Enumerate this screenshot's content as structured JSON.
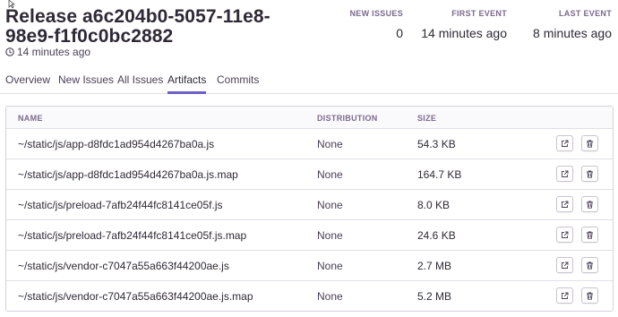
{
  "release": {
    "title": "Release a6c204b0-5057-11e8-98e9-f1f0c0bc2882",
    "age": "14 minutes ago"
  },
  "stats": {
    "new_issues_label": "NEW ISSUES",
    "new_issues_value": "0",
    "first_event_label": "FIRST EVENT",
    "first_event_value": "14 minutes ago",
    "last_event_label": "LAST EVENT",
    "last_event_value": "8 minutes ago"
  },
  "tabs": [
    {
      "label": "Overview",
      "active": false
    },
    {
      "label": "New Issues",
      "active": false
    },
    {
      "label": "All Issues",
      "active": false
    },
    {
      "label": "Artifacts",
      "active": true
    },
    {
      "label": "Commits",
      "active": false
    }
  ],
  "table": {
    "headers": {
      "name": "NAME",
      "distribution": "DISTRIBUTION",
      "size": "SIZE"
    },
    "rows": [
      {
        "name": "~/static/js/app-d8fdc1ad954d4267ba0a.js",
        "distribution": "None",
        "size": "54.3 KB"
      },
      {
        "name": "~/static/js/app-d8fdc1ad954d4267ba0a.js.map",
        "distribution": "None",
        "size": "164.7 KB"
      },
      {
        "name": "~/static/js/preload-7afb24f44fc8141ce05f.js",
        "distribution": "None",
        "size": "8.0 KB"
      },
      {
        "name": "~/static/js/preload-7afb24f44fc8141ce05f.js.map",
        "distribution": "None",
        "size": "24.6 KB"
      },
      {
        "name": "~/static/js/vendor-c7047a55a663f44200ae.js",
        "distribution": "None",
        "size": "2.7 MB"
      },
      {
        "name": "~/static/js/vendor-c7047a55a663f44200ae.js.map",
        "distribution": "None",
        "size": "5.2 MB"
      }
    ]
  },
  "icons": {
    "clock": "clock-icon",
    "open": "external-link-icon",
    "delete": "trash-icon"
  },
  "colors": {
    "accent": "#6c5fc7",
    "text": "#2f2936",
    "muted": "#7c6a8e",
    "border": "#e2dee6"
  }
}
